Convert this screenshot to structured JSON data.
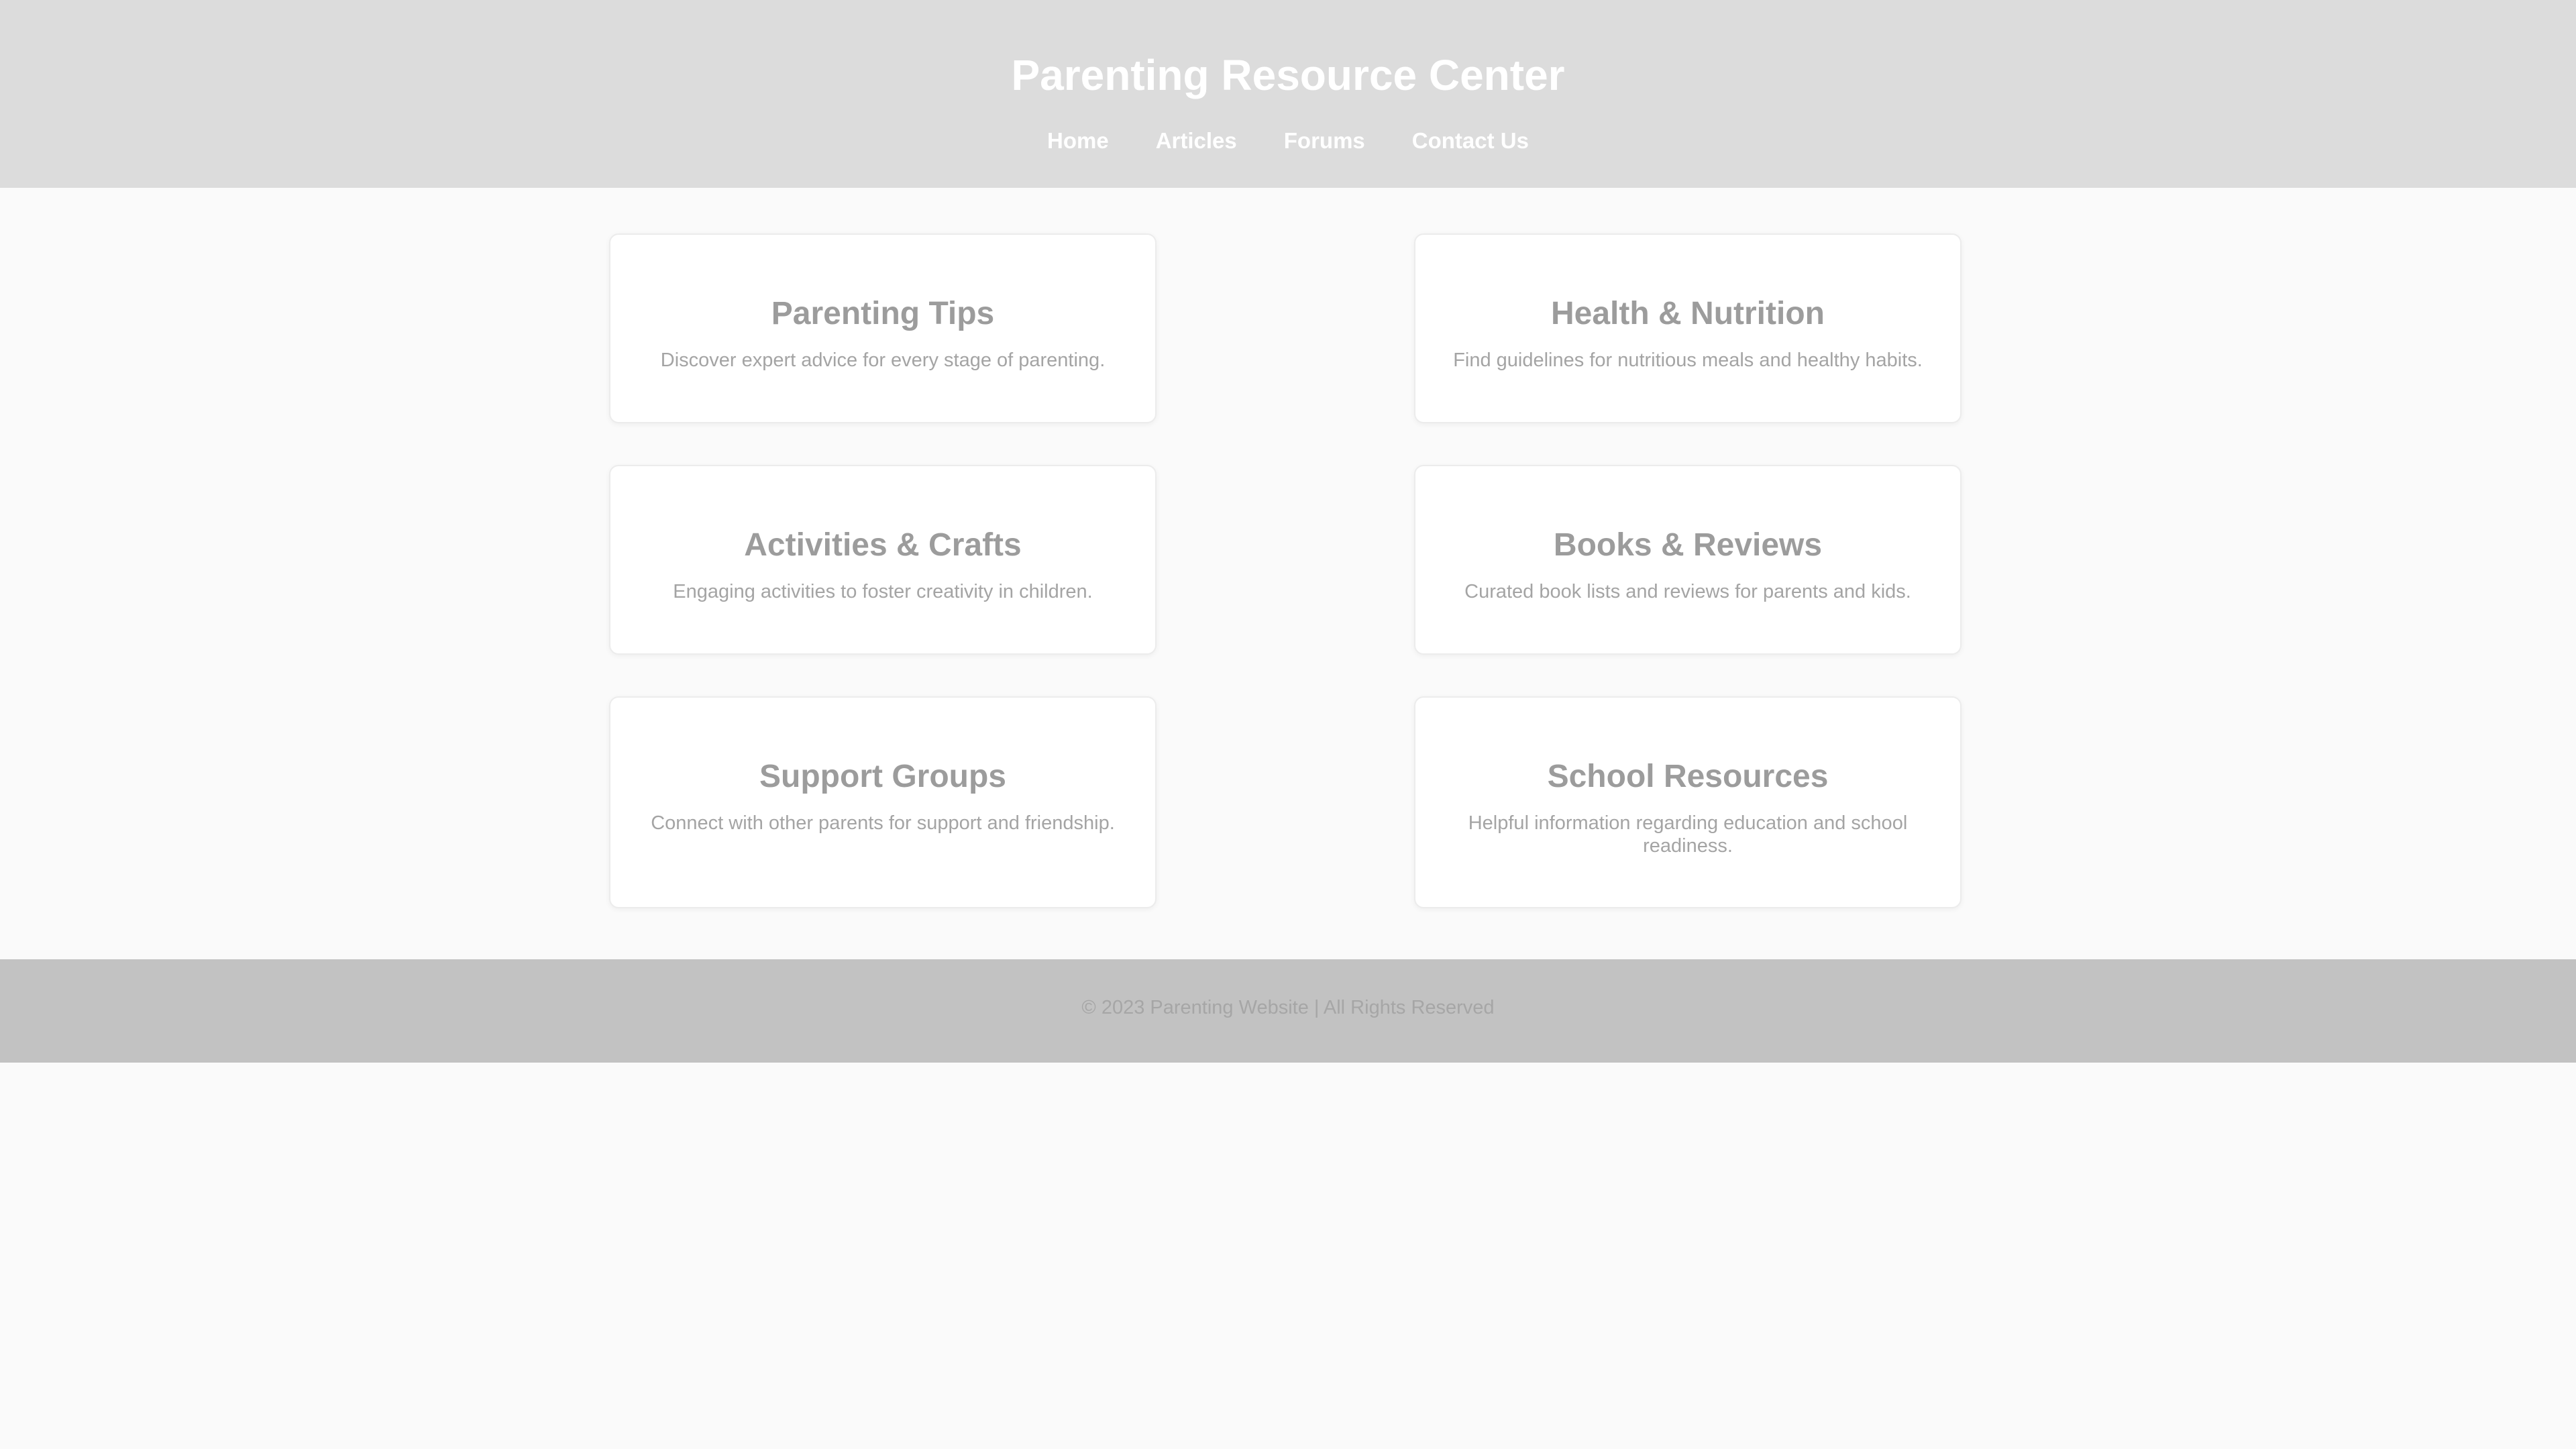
{
  "header": {
    "title": "Parenting Resource Center",
    "nav": [
      "Home",
      "Articles",
      "Forums",
      "Contact Us"
    ]
  },
  "cards": [
    {
      "title": "Parenting Tips",
      "description": "Discover expert advice for every stage of parenting."
    },
    {
      "title": "Health & Nutrition",
      "description": "Find guidelines for nutritious meals and healthy habits."
    },
    {
      "title": "Activities & Crafts",
      "description": "Engaging activities to foster creativity in children."
    },
    {
      "title": "Books & Reviews",
      "description": "Curated book lists and reviews for parents and kids."
    },
    {
      "title": "Support Groups",
      "description": "Connect with other parents for support and friendship."
    },
    {
      "title": "School Resources",
      "description": "Helpful information regarding education and school readiness."
    }
  ],
  "footer": {
    "text": "© 2023 Parenting Website | All Rights Reserved"
  },
  "colors": {
    "header_bg": "#dcdcdc",
    "footer_bg": "#c2c2c2",
    "page_bg": "#fafafa",
    "card_bg": "#ffffff",
    "card_text": "#9c9c9c"
  }
}
